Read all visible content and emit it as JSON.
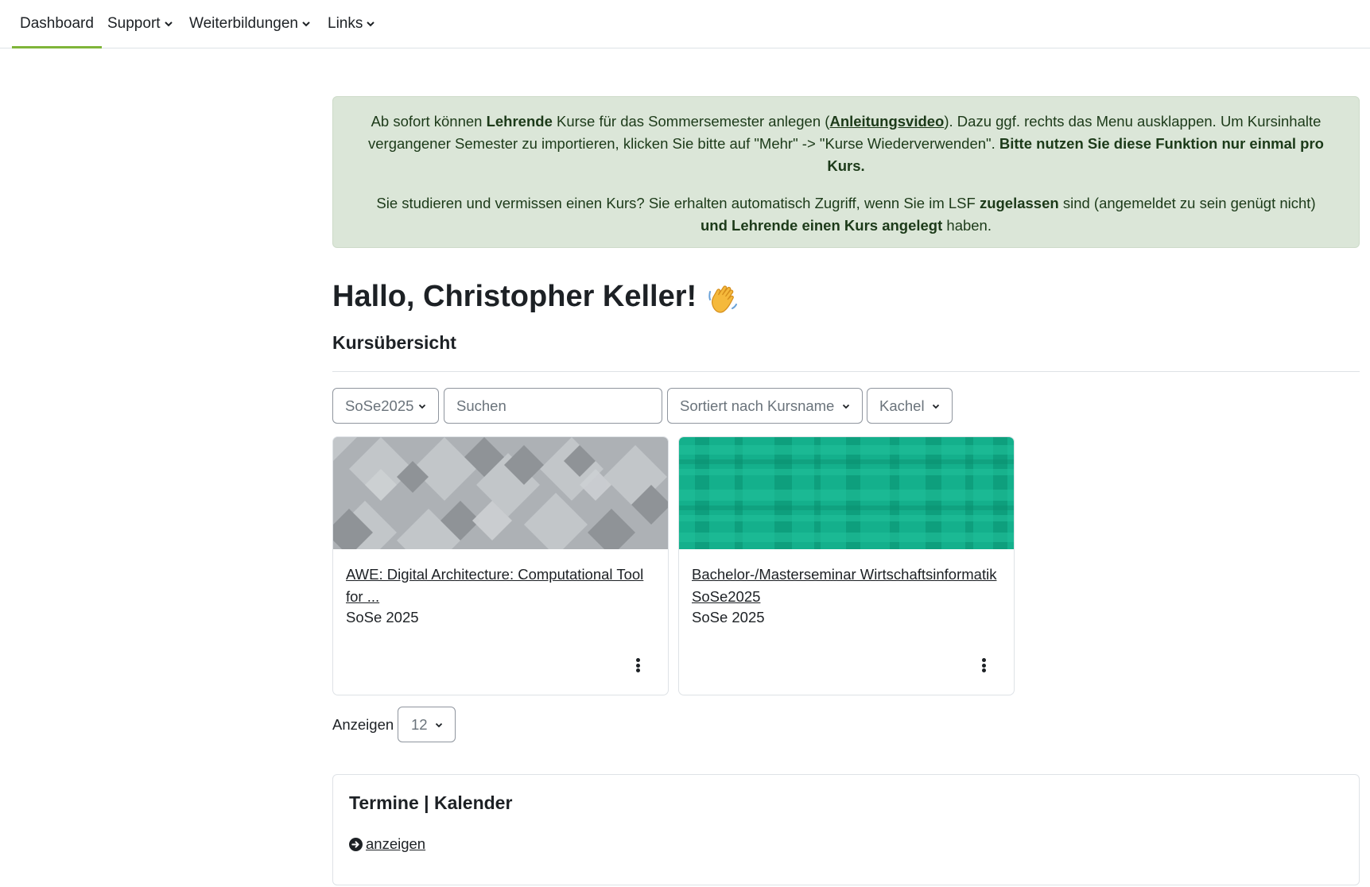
{
  "nav": {
    "items": [
      {
        "label": "Dashboard",
        "active": true,
        "dropdown": false
      },
      {
        "label": "Support",
        "dropdown": true
      },
      {
        "label": "Weiterbildungen",
        "dropdown": true
      },
      {
        "label": "Links",
        "dropdown": true
      }
    ],
    "accent_color": "#7fb539"
  },
  "alert": {
    "p1_pre": "Ab sofort können ",
    "p1_bold1": "Lehrende",
    "p1_mid": " Kurse für das Sommersemester anlegen (",
    "p1_link": "Anleitungsvideo",
    "p1_post": "). Dazu ggf. rechts das Menu ausklappen. Um Kursinhalte vergangener Semester zu importieren, klicken Sie bitte auf \"Mehr\" -> \"Kurse Wiederverwenden\". ",
    "p1_bold2": "Bitte nutzen Sie diese Funktion nur einmal pro Kurs.",
    "p2_pre": "Sie studieren und vermissen einen Kurs? Sie erhalten automatisch Zugriff, wenn Sie im LSF ",
    "p2_bold1": "zugelassen",
    "p2_mid": " sind (angemeldet zu sein genügt nicht) ",
    "p2_bold2": "und Lehrende einen Kurs angelegt",
    "p2_post": " haben.",
    "bg_color": "#dbe6d8"
  },
  "greeting": "Hallo, Christopher Keller!",
  "greeting_icon": "waving-hand-icon",
  "section_title": "Kursübersicht",
  "filters": {
    "grouping": "SoSe2025",
    "search_placeholder": "Suchen",
    "sort": "Sortiert nach Kursname",
    "view": "Kachel"
  },
  "courses": [
    {
      "title": "AWE: Digital Architecture: Computational Tool for ...",
      "term": "SoSe 2025",
      "pattern": "grey-diamonds"
    },
    {
      "title": "Bachelor-/Masterseminar Wirtschaftsinformatik SoSe2025",
      "term": "SoSe 2025",
      "pattern": "teal-plaid"
    }
  ],
  "pagination": {
    "label": "Anzeigen",
    "per_page": "12"
  },
  "calendar_block": {
    "title": "Termine | Kalender",
    "link": "anzeigen",
    "link_icon": "arrow-circle-right-icon"
  }
}
